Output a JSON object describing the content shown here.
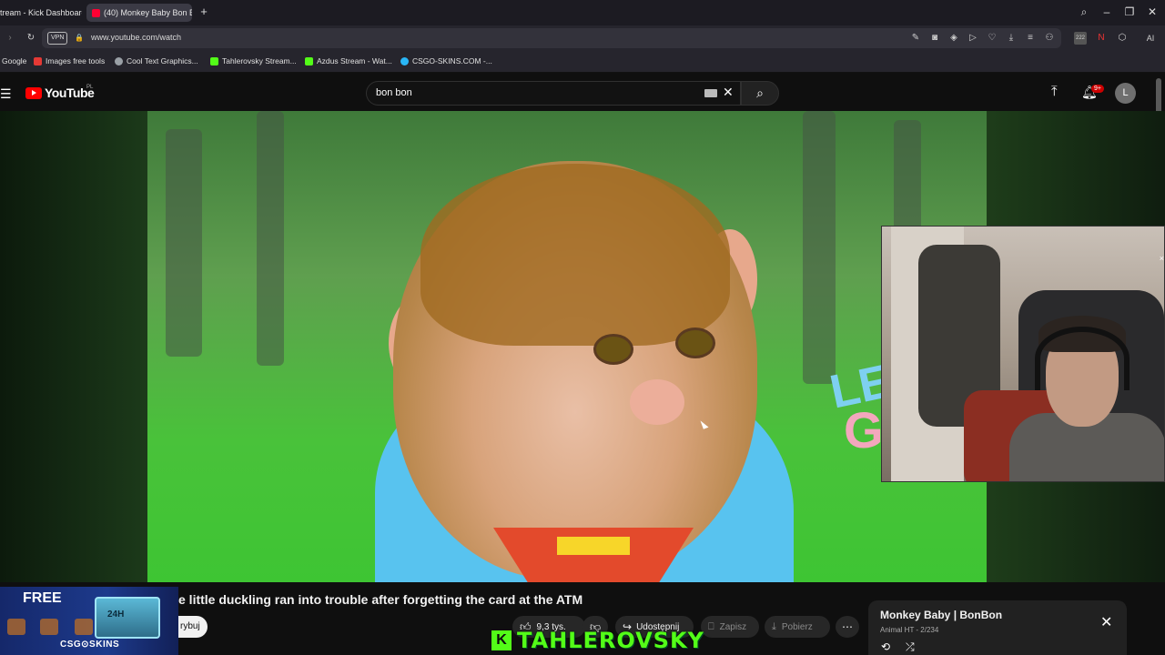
{
  "browser": {
    "tabs": [
      {
        "label": "tream - Kick Dashboard",
        "active": false
      },
      {
        "label": "(40) Monkey Baby Bon Bo",
        "active": true
      }
    ],
    "new_tab": "+",
    "url": "www.youtube.com/watch",
    "vpn_label": "VPN",
    "ext_badge": "222",
    "ai_label": "AI",
    "bookmarks": [
      {
        "label": "Google",
        "color": "#4285f4"
      },
      {
        "label": "Images free tools",
        "color": "#e53935"
      },
      {
        "label": "Cool Text Graphics...",
        "color": "#9aa0a6"
      },
      {
        "label": "Tahlerovsky Stream...",
        "color": "#53fc18"
      },
      {
        "label": "Azdus Stream - Wat...",
        "color": "#53fc18"
      },
      {
        "label": "CSGO-SKINS.COM -...",
        "color": "#29b6f6"
      }
    ]
  },
  "youtube": {
    "logo_text": "YouTube",
    "country_code": "PL",
    "search_value": "bon bon",
    "notifications_badge": "9+",
    "avatar_letter": "L",
    "video_title": "e little duckling ran into trouble after forgetting the card at the ATM",
    "subscribe_label": "rybuj",
    "actions": {
      "likes": "9,3 tys.",
      "share": "Udostępnij",
      "save": "Zapisz",
      "download": "Pobierz",
      "more": "⋯"
    },
    "playlist": {
      "title": "Monkey Baby | BonBon",
      "subtitle": "Animal HT - 2/234"
    },
    "overlay_text": {
      "lets": "LET",
      "g": "G"
    }
  },
  "ad": {
    "free_label": "FREE",
    "crate_label": "24H",
    "brand": "CSG⊙SKINS"
  },
  "streamer": {
    "k_logo": "K",
    "name": "TAHLEROVSKY"
  },
  "colors": {
    "kick_green": "#53fc18",
    "youtube_red": "#ff0000"
  }
}
